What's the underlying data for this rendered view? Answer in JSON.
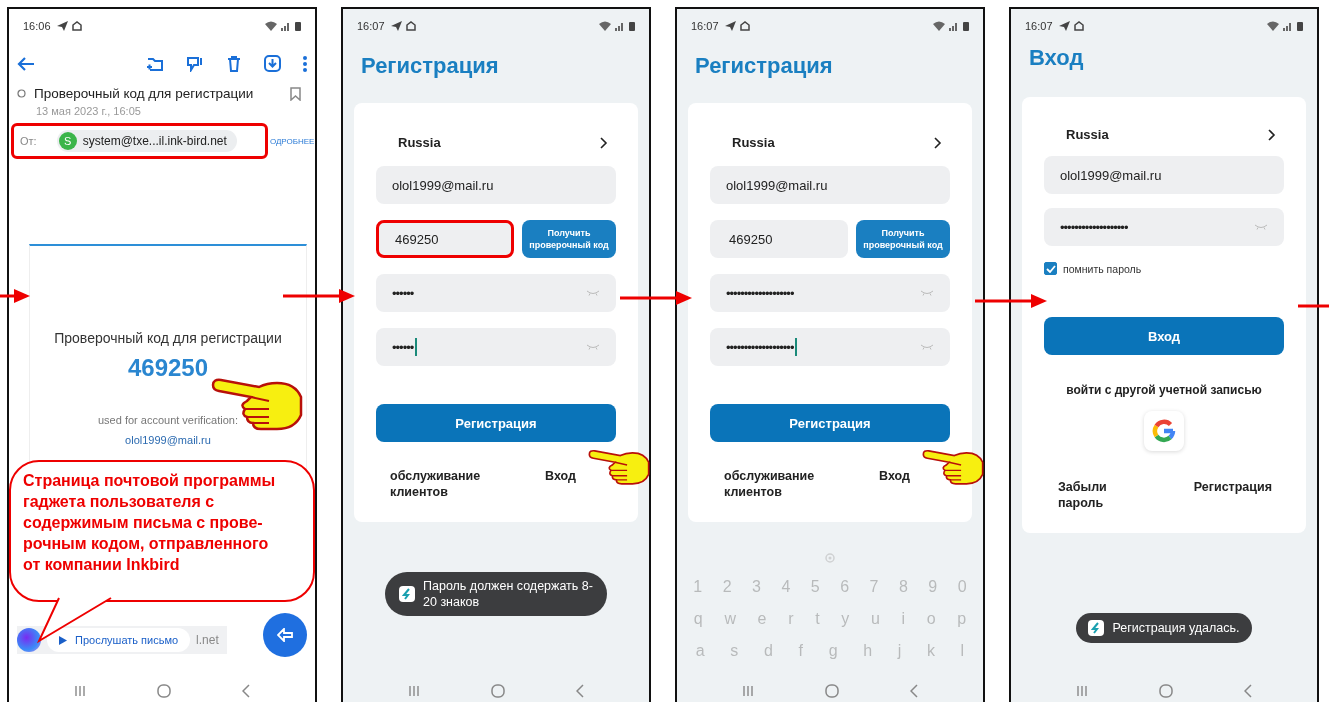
{
  "screens": [
    {
      "kind": "email",
      "status_time": "16:06",
      "pointer_hand": true,
      "subject": "Проверочный код для регистрации",
      "date": "13 мая 2023 г., 16:05",
      "from_label": "От:",
      "sender_initial": "S",
      "sender": "system@txe...il.ink-bird.net",
      "sender_highlighted": true,
      "details_link": "ОДРОБНЕЕ",
      "body_title": "Проверочный код для регистрации",
      "code": "469250",
      "note": "used for account verification:",
      "email": "olol1999@mail.ru",
      "callout": "Страница почтовой программы гаджета пользователя с содержимым письма с прове-рочным кодом, отправленного от компании Inkbird",
      "listen_button": "Прослушать письмо",
      "sender_tail": "l.net"
    },
    {
      "kind": "register",
      "status_time": "16:07",
      "pointer_hand": true,
      "title": "Регистрация",
      "country": "Russia",
      "email": "olol1999@mail.ru",
      "code": "469250",
      "code_highlighted": true,
      "get_code_button": "Получить проверочный код",
      "password": "••••••",
      "password_confirm": "••••••",
      "confirm_focused": true,
      "register_button": "Регистрация",
      "support_link": "обслуживание клиентов",
      "login_link": "Вход",
      "toast": "Пароль должен содержать 8-20 знаков"
    },
    {
      "kind": "register",
      "status_time": "16:07",
      "pointer_hand": true,
      "title": "Регистрация",
      "country": "Russia",
      "email": "olol1999@mail.ru",
      "code": "469250",
      "code_highlighted": false,
      "get_code_button": "Получить проверочный код",
      "password": "•••••••••••••••••••",
      "password_confirm": "•••••••••••••••••••",
      "confirm_focused": true,
      "register_button": "Регистрация",
      "support_link": "обслуживание клиентов",
      "login_link": "Вход",
      "keyboard": [
        [
          "1",
          "2",
          "3",
          "4",
          "5",
          "6",
          "7",
          "8",
          "9",
          "0"
        ],
        [
          "q",
          "w",
          "e",
          "r",
          "t",
          "y",
          "u",
          "i",
          "o",
          "p"
        ],
        [
          "a",
          "s",
          "d",
          "f",
          "g",
          "h",
          "j",
          "k",
          "l"
        ]
      ]
    },
    {
      "kind": "login",
      "status_time": "16:07",
      "pointer_hand": false,
      "title": "Вход",
      "country": "Russia",
      "email": "olol1999@mail.ru",
      "password": "•••••••••••••••••••",
      "remember_label": "помнить пароль",
      "remember_checked": true,
      "login_button": "Вход",
      "alt_login": "войти с другой учетной записью",
      "forgot_link": "Забыли пароль",
      "register_link": "Регистрация",
      "toast": "Регистрация удалась."
    }
  ]
}
